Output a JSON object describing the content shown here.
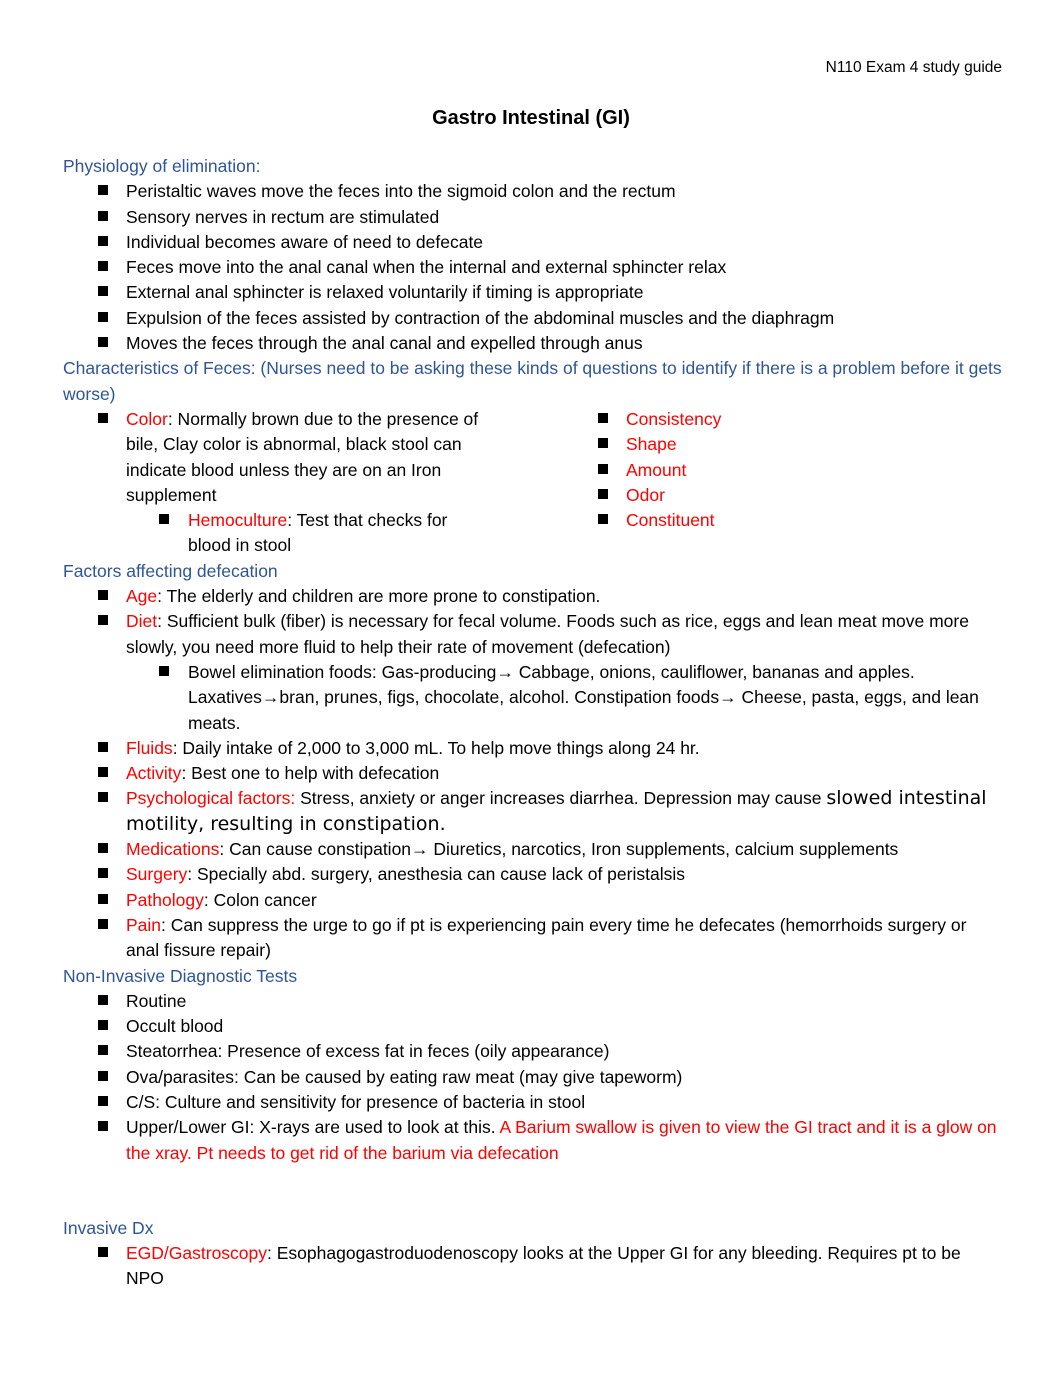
{
  "header": {
    "right_text": "N110 Exam 4 study guide"
  },
  "title": "Gastro Intestinal (GI)",
  "sections": {
    "physiology": {
      "heading": "Physiology of elimination:",
      "items": [
        "Peristaltic waves move the feces into the sigmoid colon and the rectum",
        "Sensory nerves in rectum are stimulated",
        "Individual becomes aware of need to defecate",
        "Feces move into the anal canal when the internal and external sphincter relax",
        "External anal sphincter is relaxed voluntarily if timing is appropriate",
        "Expulsion of the feces assisted by contraction of the abdominal muscles and the diaphragm",
        "Moves the feces through the anal canal and expelled through anus"
      ]
    },
    "characteristics": {
      "heading": "Characteristics of Feces: (Nurses need to be asking these kinds of questions to identify if there is a problem before it gets worse)",
      "color": {
        "label": "Color",
        "text": ":  Normally brown due to the presence of bile, Clay color is abnormal, black stool can indicate blood unless they are on an Iron supplement"
      },
      "hemoculture": {
        "label": "Hemoculture",
        "text": ":  Test that checks for blood in stool"
      },
      "right_items": [
        "Consistency",
        "Shape",
        "Amount",
        "Odor",
        "Constituent"
      ]
    },
    "factors": {
      "heading": "Factors affecting defecation",
      "age": {
        "label": "Age",
        "text": ":  The elderly and children are more prone to constipation."
      },
      "diet": {
        "label": "Diet",
        "text": ":  Sufficient bulk (fiber) is necessary for fecal volume. Foods such as rice, eggs and lean meat move more slowly, you need more fluid to help their rate of movement (defecation)"
      },
      "diet_sub": "Bowel elimination foods:  Gas-producing→ Cabbage, onions, cauliflower, bananas and apples. Laxatives→bran, prunes, figs, chocolate, alcohol.  Constipation foods→  Cheese, pasta, eggs, and lean meats.",
      "fluids": {
        "label": "Fluids",
        "text": ":  Daily intake of 2,000 to 3,000 mL.  To help move things along 24 hr."
      },
      "activity": {
        "label": "Activity",
        "text": ":  Best one to help with defecation"
      },
      "psych": {
        "label": "Psychological factors:",
        "text": "  Stress, anxiety or anger increases diarrhea.  Depression may cause ",
        "big_text": "slowed intestinal motility, resulting in constipation."
      },
      "medications": {
        "label": "Medications",
        "text": ":  Can cause constipation→ Diuretics, narcotics, Iron supplements, calcium supplements"
      },
      "surgery": {
        "label": "Surgery",
        "text": ":  Specially abd. surgery, anesthesia can cause lack of peristalsis"
      },
      "pathology": {
        "label": "Pathology",
        "text": ":  Colon cancer"
      },
      "pain": {
        "label": "Pain",
        "text": ": Can suppress the urge to go if pt is experiencing pain every time he defecates (hemorrhoids surgery or anal fissure repair)"
      }
    },
    "noninvasive": {
      "heading": "Non-Invasive Diagnostic Tests",
      "items": [
        "Routine",
        "Occult blood",
        "Steatorrhea: Presence of excess fat in feces (oily appearance)",
        "Ova/parasites:  Can be caused by eating raw meat (may give tapeworm)",
        "C/S:  Culture and sensitivity for presence of bacteria in stool"
      ],
      "upper_lower": {
        "text": "Upper/Lower GI:  X-rays are used to look at this.  ",
        "red_text": "A Barium swallow is given to view the GI tract and it is a glow on the xray.  Pt needs to get rid of the barium via defecation"
      }
    },
    "invasive": {
      "heading": "Invasive Dx",
      "egd": {
        "label": "EGD/Gastroscopy",
        "text": ":  Esophagogastroduodenoscopy looks at the Upper GI for any bleeding.  Requires pt to be NPO"
      }
    }
  }
}
